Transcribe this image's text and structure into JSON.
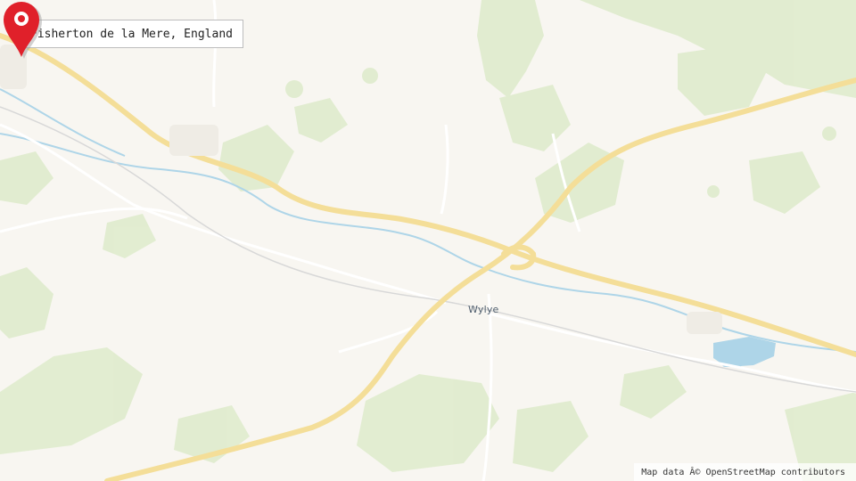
{
  "map": {
    "location_title": "Fisherton de la Mere, England",
    "place_label": "Wylye",
    "attribution": "Map data Â© OpenStreetMap contributors",
    "marker_icon": "map-pin-icon",
    "colors": {
      "background": "#f8f6f1",
      "green_area": "#dfeccd",
      "road_major": "#f4de98",
      "road_minor": "#ffffff",
      "water": "#aed5e8",
      "marker": "#e0202a"
    }
  }
}
